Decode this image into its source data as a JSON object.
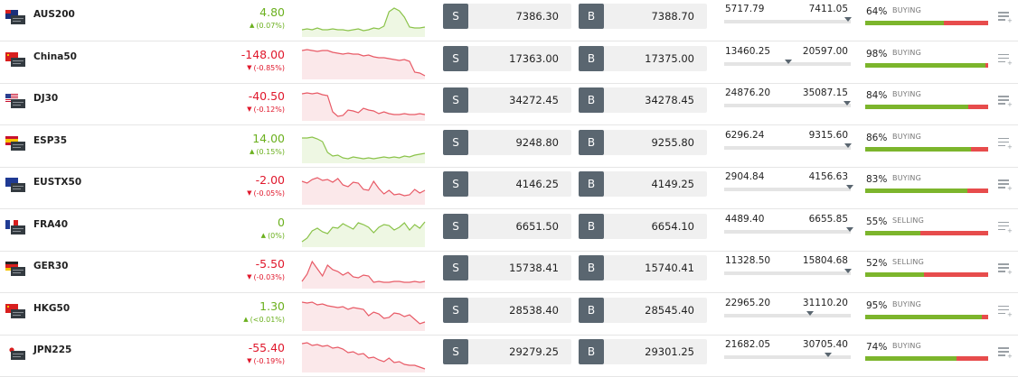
{
  "colors": {
    "up": "#6bb01e",
    "down": "#e0182c",
    "buy_fill": "#7cb52c",
    "sell_fill": "#e74c4c",
    "button_tag": "#5a6670"
  },
  "rows": [
    {
      "symbol": "AUS200",
      "flag": "au",
      "change": "4.80",
      "change_pct": "(0.07%)",
      "dir": "up",
      "sell_label": "S",
      "sell_price": "7386.30",
      "buy_label": "B",
      "buy_price": "7388.70",
      "range_low": "5717.79",
      "range_high": "7411.05",
      "range_pos": 0.98,
      "sentiment_pct": "64%",
      "sentiment_label": "BUYING",
      "buying_share": 0.64,
      "spark": [
        6,
        7,
        6,
        8,
        6,
        6,
        7,
        6,
        6,
        5,
        6,
        7,
        5,
        6,
        8,
        7,
        10,
        26,
        30,
        27,
        20,
        9,
        8,
        8,
        9
      ]
    },
    {
      "symbol": "China50",
      "flag": "cn",
      "change": "-148.00",
      "change_pct": "(-0.85%)",
      "dir": "down",
      "sell_label": "S",
      "sell_price": "17363.00",
      "buy_label": "B",
      "buy_price": "17375.00",
      "range_low": "13460.25",
      "range_high": "20597.00",
      "range_pos": 0.51,
      "sentiment_pct": "98%",
      "sentiment_label": "BUYING",
      "buying_share": 0.98,
      "spark": [
        30,
        31,
        30,
        29,
        30,
        30,
        28,
        27,
        26,
        27,
        26,
        26,
        24,
        25,
        23,
        22,
        22,
        21,
        20,
        19,
        20,
        18,
        6,
        5,
        2
      ]
    },
    {
      "symbol": "DJ30",
      "flag": "us",
      "change": "-40.50",
      "change_pct": "(-0.12%)",
      "dir": "down",
      "sell_label": "S",
      "sell_price": "34272.45",
      "buy_label": "B",
      "buy_price": "34278.45",
      "range_low": "24876.20",
      "range_high": "35087.15",
      "range_pos": 0.97,
      "sentiment_pct": "84%",
      "sentiment_label": "BUYING",
      "buying_share": 0.84,
      "spark": [
        28,
        29,
        28,
        29,
        27,
        26,
        8,
        3,
        4,
        10,
        9,
        7,
        12,
        10,
        9,
        6,
        8,
        6,
        5,
        5,
        6,
        5,
        5,
        6,
        5
      ]
    },
    {
      "symbol": "ESP35",
      "flag": "es",
      "change": "14.00",
      "change_pct": "(0.15%)",
      "dir": "up",
      "sell_label": "S",
      "sell_price": "9248.80",
      "buy_label": "B",
      "buy_price": "9255.80",
      "range_low": "6296.24",
      "range_high": "9315.60",
      "range_pos": 0.98,
      "sentiment_pct": "86%",
      "sentiment_label": "BUYING",
      "buying_share": 0.86,
      "spark": [
        26,
        26,
        27,
        25,
        22,
        10,
        6,
        7,
        4,
        3,
        5,
        4,
        3,
        4,
        3,
        4,
        5,
        4,
        5,
        4,
        6,
        5,
        7,
        8,
        9
      ]
    },
    {
      "symbol": "EUSTX50",
      "flag": "eu",
      "change": "-2.00",
      "change_pct": "(-0.05%)",
      "dir": "down",
      "sell_label": "S",
      "sell_price": "4146.25",
      "buy_label": "B",
      "buy_price": "4149.25",
      "range_low": "2904.84",
      "range_high": "4156.63",
      "range_pos": 0.99,
      "sentiment_pct": "83%",
      "sentiment_label": "BUYING",
      "buying_share": 0.83,
      "spark": [
        24,
        22,
        26,
        28,
        25,
        26,
        23,
        27,
        20,
        18,
        23,
        22,
        15,
        14,
        24,
        16,
        10,
        14,
        9,
        10,
        8,
        9,
        15,
        11,
        14
      ]
    },
    {
      "symbol": "FRA40",
      "flag": "fr",
      "change": "0",
      "change_pct": "(0%)",
      "dir": "up",
      "sell_label": "S",
      "sell_price": "6651.50",
      "buy_label": "B",
      "buy_price": "6654.10",
      "range_low": "4489.40",
      "range_high": "6655.85",
      "range_pos": 0.99,
      "sentiment_pct": "55%",
      "sentiment_label": "SELLING",
      "buying_share": 0.45,
      "spark": [
        4,
        8,
        16,
        19,
        15,
        13,
        20,
        19,
        24,
        21,
        18,
        25,
        23,
        20,
        14,
        20,
        23,
        22,
        17,
        20,
        25,
        17,
        23,
        19,
        26
      ]
    },
    {
      "symbol": "GER30",
      "flag": "de",
      "change": "-5.50",
      "change_pct": "(-0.03%)",
      "dir": "down",
      "sell_label": "S",
      "sell_price": "15738.41",
      "buy_label": "B",
      "buy_price": "15740.41",
      "range_low": "11328.50",
      "range_high": "15804.68",
      "range_pos": 0.98,
      "sentiment_pct": "52%",
      "sentiment_label": "SELLING",
      "buying_share": 0.48,
      "spark": [
        6,
        14,
        28,
        20,
        12,
        24,
        19,
        17,
        13,
        16,
        11,
        10,
        13,
        12,
        5,
        6,
        5,
        5,
        6,
        6,
        5,
        5,
        6,
        5,
        6
      ]
    },
    {
      "symbol": "HKG50",
      "flag": "hk",
      "change": "1.30",
      "change_pct": "(<0.01%)",
      "dir": "up",
      "sell_label": "S",
      "sell_price": "28538.40",
      "buy_label": "B",
      "buy_price": "28545.40",
      "range_low": "22965.20",
      "range_high": "31110.20",
      "range_pos": 0.68,
      "sentiment_pct": "95%",
      "sentiment_label": "BUYING",
      "buying_share": 0.95,
      "spark": [
        30,
        29,
        30,
        27,
        28,
        26,
        25,
        24,
        25,
        22,
        24,
        23,
        22,
        15,
        19,
        17,
        12,
        13,
        18,
        17,
        14,
        16,
        11,
        6,
        8
      ]
    },
    {
      "symbol": "JPN225",
      "flag": "jp",
      "change": "-55.40",
      "change_pct": "(-0.19%)",
      "dir": "down",
      "sell_label": "S",
      "sell_price": "29279.25",
      "buy_label": "B",
      "buy_price": "29301.25",
      "range_low": "21682.05",
      "range_high": "30705.40",
      "range_pos": 0.82,
      "sentiment_pct": "74%",
      "sentiment_label": "BUYING",
      "buying_share": 0.74,
      "spark": [
        30,
        31,
        28,
        29,
        27,
        28,
        25,
        26,
        24,
        20,
        21,
        18,
        19,
        14,
        15,
        12,
        10,
        14,
        9,
        10,
        7,
        6,
        6,
        4,
        2
      ]
    }
  ]
}
